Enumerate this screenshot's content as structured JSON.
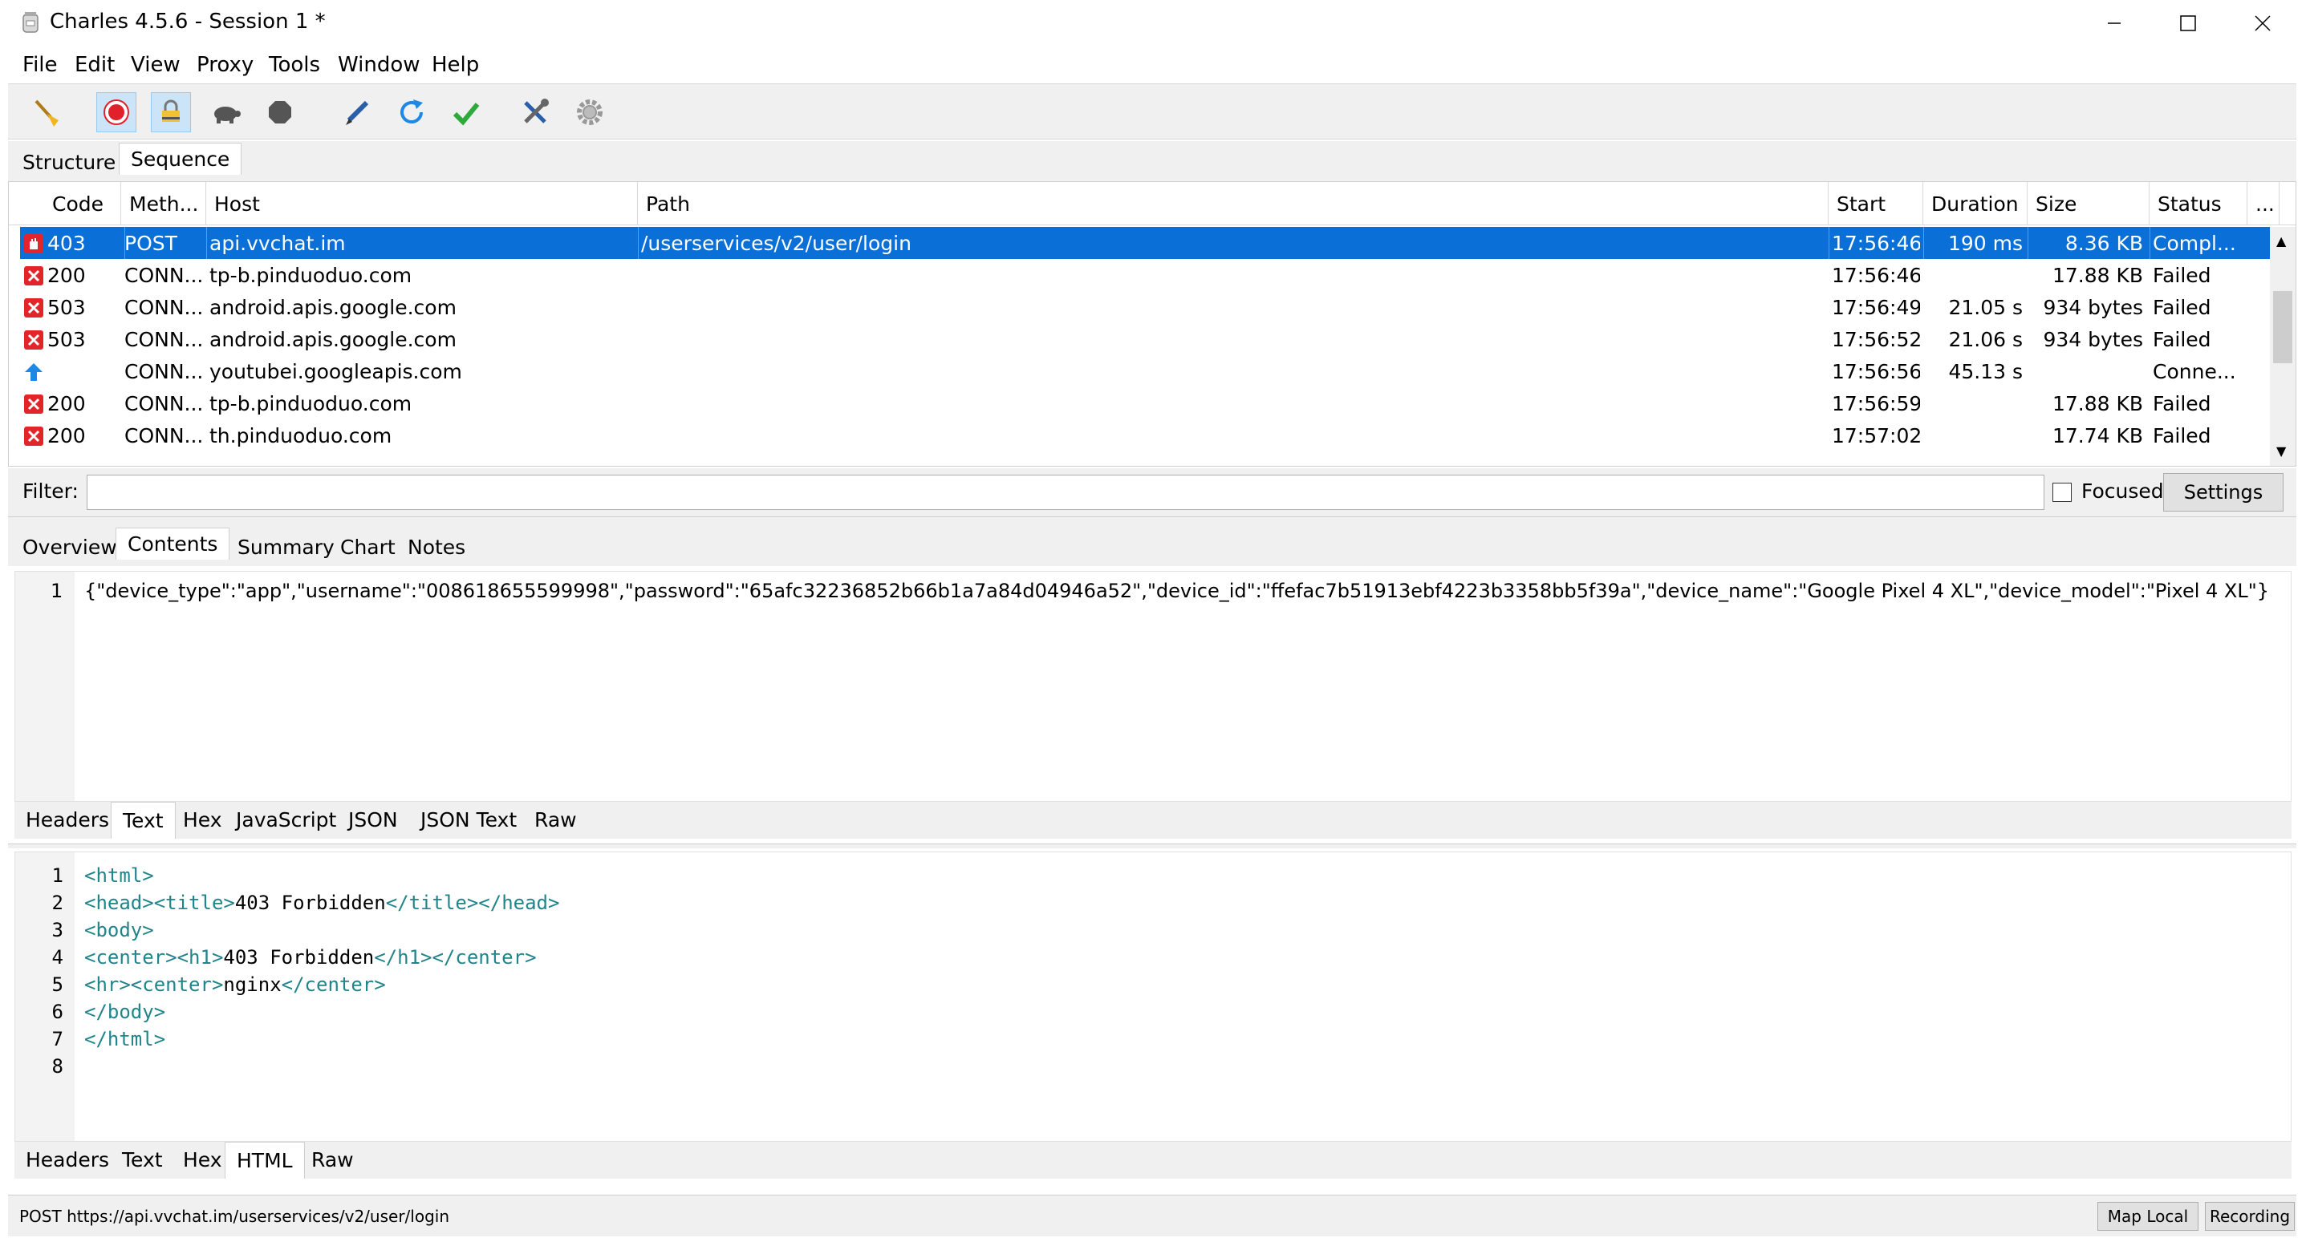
{
  "window": {
    "title": "Charles 4.5.6 - Session 1 *"
  },
  "menu": [
    "File",
    "Edit",
    "View",
    "Proxy",
    "Tools",
    "Window",
    "Help"
  ],
  "view_tabs": [
    "Structure",
    "Sequence"
  ],
  "columns": [
    "Code",
    "Meth...",
    "Host",
    "Path",
    "Start",
    "Duration",
    "Size",
    "Status",
    "..."
  ],
  "rows": [
    {
      "status_icon": "blocked-icon",
      "code": "403",
      "method": "POST",
      "host": "api.vvchat.im",
      "path": "/userservices/v2/user/login",
      "start": "17:56:46",
      "duration": "190 ms",
      "size": "8.36 KB",
      "status": "Compl..."
    },
    {
      "status_icon": "error-icon",
      "code": "200",
      "method": "CONN...",
      "host": "tp-b.pinduoduo.com",
      "path": "",
      "start": "17:56:46",
      "duration": "",
      "size": "17.88 KB",
      "status": "Failed"
    },
    {
      "status_icon": "error-icon",
      "code": "503",
      "method": "CONN...",
      "host": "android.apis.google.com",
      "path": "",
      "start": "17:56:49",
      "duration": "21.05 s",
      "size": "934 bytes",
      "status": "Failed"
    },
    {
      "status_icon": "error-icon",
      "code": "503",
      "method": "CONN...",
      "host": "android.apis.google.com",
      "path": "",
      "start": "17:56:52",
      "duration": "21.06 s",
      "size": "934 bytes",
      "status": "Failed"
    },
    {
      "status_icon": "upload-arrow-icon",
      "code": "",
      "method": "CONN...",
      "host": "youtubei.googleapis.com",
      "path": "",
      "start": "17:56:56",
      "duration": "45.13 s",
      "size": "",
      "status": "Conne..."
    },
    {
      "status_icon": "error-icon",
      "code": "200",
      "method": "CONN...",
      "host": "tp-b.pinduoduo.com",
      "path": "",
      "start": "17:56:59",
      "duration": "",
      "size": "17.88 KB",
      "status": "Failed"
    },
    {
      "status_icon": "error-icon",
      "code": "200",
      "method": "CONN...",
      "host": "th.pinduoduo.com",
      "path": "",
      "start": "17:57:02",
      "duration": "",
      "size": "17.74 KB",
      "status": "Failed"
    }
  ],
  "filter": {
    "label": "Filter:",
    "value": "",
    "focused_label": "Focused",
    "settings_label": "Settings"
  },
  "detail_tabs": [
    "Overview",
    "Contents",
    "Summary",
    "Chart",
    "Notes"
  ],
  "request": {
    "line_number": "1",
    "body": "{\"device_type\":\"app\",\"username\":\"008618655599998\",\"password\":\"65afc32236852b66b1a7a84d04946a52\",\"device_id\":\"ffefac7b51913ebf4223b3358bb5f39a\",\"device_name\":\"Google Pixel 4 XL\",\"device_model\":\"Pixel 4 XL\"}",
    "tabs": [
      "Headers",
      "Text",
      "Hex",
      "JavaScript",
      "JSON",
      "JSON Text",
      "Raw"
    ]
  },
  "response": {
    "lines": [
      "<html>",
      "<head><title>403 Forbidden</title></head>",
      "<body>",
      "<center><h1>403 Forbidden</h1></center>",
      "<hr><center>nginx</center>",
      "</body>",
      "</html>",
      ""
    ],
    "tabs": [
      "Headers",
      "Text",
      "Hex",
      "HTML",
      "Raw"
    ]
  },
  "statusbar": {
    "text": "POST https://api.vvchat.im/userservices/v2/user/login",
    "map_local": "Map Local",
    "recording": "Recording"
  },
  "colors": {
    "selection": "#0a6fd6",
    "error": "#e3252b",
    "tag": "#20858a",
    "record": "#e0212b"
  }
}
